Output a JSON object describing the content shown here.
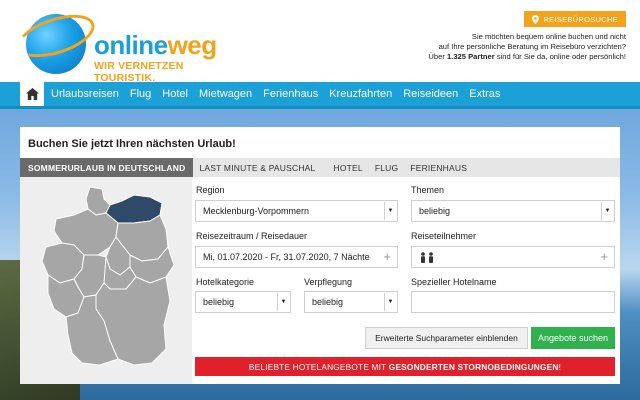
{
  "brand": {
    "name_part1": "online",
    "name_part2": "weg",
    "tagline": "WIR VERNETZEN TOURISTIK."
  },
  "header": {
    "reisebuero_button": "REISEBÜROSUCHE",
    "info_line1": "Sie möchten bequem online buchen und nicht",
    "info_line2": "auf Ihre persönliche Beratung im Reisebüro verzichten?",
    "info_line3_prefix": "Über ",
    "info_line3_bold": "1.325 Partner",
    "info_line3_suffix": " sind für Sie da, online oder persönlich!"
  },
  "nav": {
    "items": [
      "Urlaubsreisen",
      "Flug",
      "Hotel",
      "Mietwagen",
      "Ferienhaus",
      "Kreuzfahrten",
      "Reiseideen",
      "Extras"
    ]
  },
  "search": {
    "title": "Buchen Sie jetzt Ihren nächsten Urlaub!",
    "tabs": [
      "SOMMERURLAUB IN DEUTSCHLAND",
      "LAST MINUTE & PAUSCHAL",
      "HOTEL",
      "FLUG",
      "FERIENHAUS"
    ],
    "region_label": "Region",
    "region_value": "Mecklenburg-Vorpommern",
    "themen_label": "Themen",
    "themen_value": "beliebig",
    "zeitraum_label": "Reisezeitraum / Reisedauer",
    "zeitraum_value": "Mi, 01.07.2020 - Fr, 31.07.2020, 7 Nächte",
    "teilnehmer_label": "Reiseteilnehmer",
    "hotelkat_label": "Hotelkategorie",
    "hotelkat_value": "beliebig",
    "verpflegung_label": "Verpflegung",
    "verpflegung_value": "beliebig",
    "hotelname_label": "Spezieller Hotelname",
    "hotelname_value": "",
    "advanced_button": "Erweiterte Suchparameter einblenden",
    "submit_button": "Angebote suchen",
    "promo_prefix": "BELIEBTE HOTELANGEBOTE MIT ",
    "promo_bold": "GESONDERTEN STORNOBEDINGUNGEN",
    "promo_suffix": "!"
  },
  "colors": {
    "brand_blue": "#1ca0d8",
    "brand_orange": "#f3a21b",
    "submit_green": "#2fb24e",
    "promo_red": "#e0212c",
    "map_selected": "#2f4a68",
    "map_default": "#a6a6a6"
  },
  "icons": {
    "home": "home-icon",
    "pin": "map-pin-icon",
    "people": "people-icon",
    "plus": "plus-icon",
    "arrow": "chevron-down-icon"
  }
}
